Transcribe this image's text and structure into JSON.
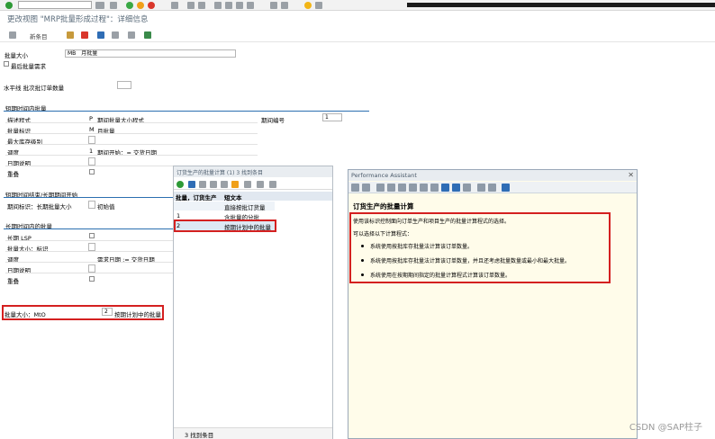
{
  "window_title": "更改视图 \"MRP批量形成过程\"：详细信息",
  "toolbar": {
    "new_entries": "新条目"
  },
  "header": {
    "lot_size_label": "批量大小",
    "lot_size_code": "MB",
    "lot_size_text": "月批量",
    "last_lot_exact_label": "最后批量需求",
    "horizon_label": "水平线 批次批订单数量"
  },
  "short_term": {
    "section_title": "短期时间内批量",
    "rows": [
      {
        "label": "描述程式",
        "code": "P",
        "text": "期间批量大小程式"
      },
      {
        "label": "批量标识",
        "code": "M",
        "text": "月批量"
      },
      {
        "label": "最大库存级别",
        "code": "",
        "text": ""
      },
      {
        "label": "调度",
        "code": "1",
        "text": "期间开始：= 交货日期"
      },
      {
        "label": "日期说明",
        "code": "",
        "text": ""
      },
      {
        "label": "重叠",
        "code": "",
        "text": ""
      }
    ],
    "period_count_label": "期间编号",
    "period_count_value": "1"
  },
  "long_term_start": {
    "section_title": "短期时间结束/长期期间开始",
    "period_label": "期间标识：长期批量大小",
    "initial_label": "初始值"
  },
  "long_term": {
    "section_title": "长期时间内的批量",
    "rows": [
      {
        "label": "长期 LSP"
      },
      {
        "label": "批量大小：标识"
      },
      {
        "label": "调度",
        "text": "需求日期 := 交货日期"
      },
      {
        "label": "日期说明"
      },
      {
        "label": "重叠"
      }
    ]
  },
  "mto": {
    "label": "批量大小：MtO",
    "code": "2",
    "text": "按期计划中的批量"
  },
  "popup_list": {
    "title": "订货生产的批量计算 (1)   3 找到条目",
    "col1": "批量，订货生产",
    "col2": "短文本",
    "rows": [
      {
        "key": "",
        "text": "直接按批订货量"
      },
      {
        "key": "1",
        "text": "含批量的分批"
      },
      {
        "key": "2",
        "text": "按期计划中的批量"
      }
    ],
    "footer": "3 找到条目"
  },
  "assistant": {
    "title": "Performance Assistant",
    "heading": "订货生产的批量计算",
    "intro": "使用该标识控制面向订单生产和项目生产的批量计算程式的选择。",
    "options_intro": "可以选择以下计算程式：",
    "bullets": [
      "系统使用按批库存批量法计算该订单数量。",
      "系统使用按批库存批量法计算该订单数量，并且还考虑批量数量或最小和最大批量。",
      "系统使用在按期期间指定的批量计算程式计算该订单数量。"
    ]
  },
  "watermark": "CSDN @SAP柱子",
  "colors": {
    "highlight_red": "#d42020",
    "section_blue": "#2b6fb0",
    "assistant_bg": "#fffcea"
  }
}
